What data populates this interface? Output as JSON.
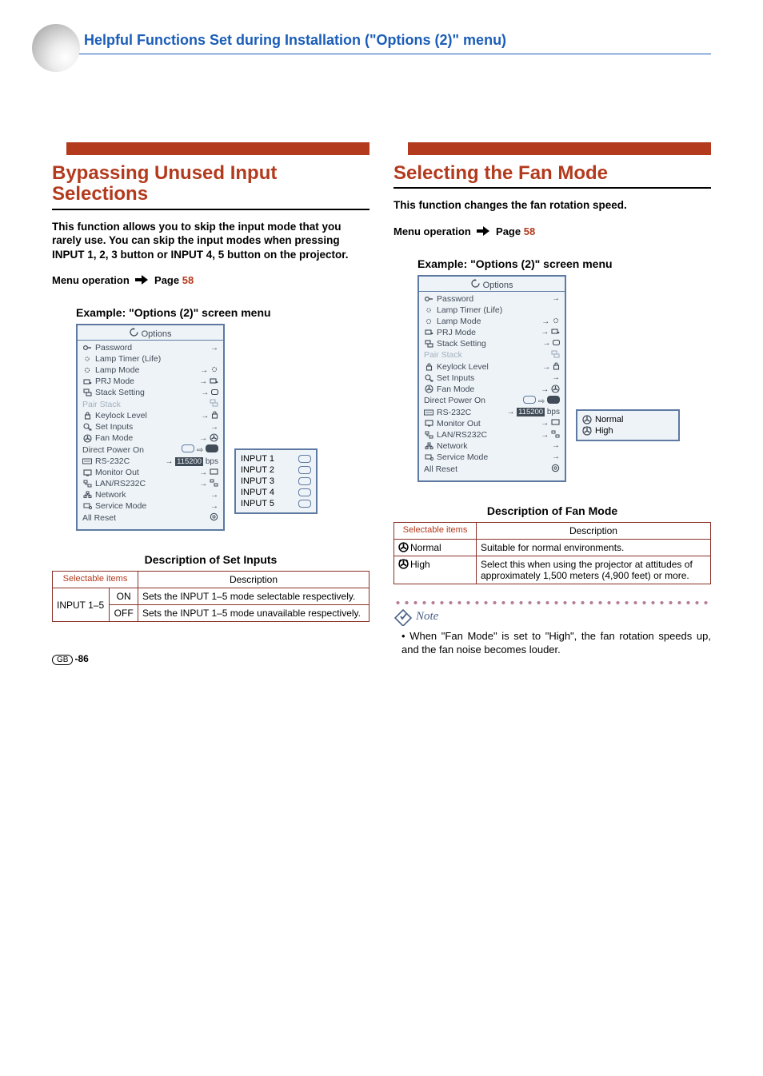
{
  "header": "Helpful Functions Set during Installation (\"Options (2)\" menu)",
  "page_number_prefix": "GB",
  "page_number": "-86",
  "menu_op_label": "Menu operation",
  "menu_op_page_word": "Page",
  "menu_op_page_num": "58",
  "left": {
    "title": "Bypassing Unused Input Selections",
    "intro": "This function allows you to skip the input mode that you rarely use. You can skip the input modes when pressing INPUT 1, 2, 3 button or INPUT 4, 5 button on the projector.",
    "example_label": "Example: \"Options (2)\" screen menu",
    "osd_title": "Options",
    "osd_items": [
      "Password",
      "Lamp Timer (Life)",
      "Lamp Mode",
      "PRJ Mode",
      "Stack Setting",
      "Pair Stack",
      "Keylock Level",
      "Set Inputs",
      "Fan Mode",
      "Direct Power On",
      "RS-232C",
      "Monitor Out",
      "LAN/RS232C",
      "Network",
      "Service Mode",
      "All Reset"
    ],
    "rs232_value": "115200",
    "rs232_unit": "bps",
    "popup_items": [
      "INPUT 1",
      "INPUT 2",
      "INPUT 3",
      "INPUT 4",
      "INPUT 5"
    ],
    "table_caption": "Description of Set Inputs",
    "table": {
      "h1": "Selectable items",
      "h2": "Description",
      "r1c1": "INPUT 1–5",
      "r1c2": "ON",
      "r1c3": "Sets the INPUT 1–5 mode selectable respectively.",
      "r2c2": "OFF",
      "r2c3": "Sets the INPUT 1–5 mode unavailable respectively."
    }
  },
  "right": {
    "title": "Selecting the Fan Mode",
    "intro": "This function changes the fan rotation speed.",
    "example_label": "Example: \"Options (2)\" screen menu",
    "osd_title": "Options",
    "osd_items": [
      "Password",
      "Lamp Timer (Life)",
      "Lamp Mode",
      "PRJ Mode",
      "Stack Setting",
      "Pair Stack",
      "Keylock Level",
      "Set Inputs",
      "Fan Mode",
      "Direct Power On",
      "RS-232C",
      "Monitor Out",
      "LAN/RS232C",
      "Network",
      "Service Mode",
      "All Reset"
    ],
    "rs232_value": "115200",
    "rs232_unit": "bps",
    "popup_items": [
      "Normal",
      "High"
    ],
    "table_caption": "Description of Fan Mode",
    "table": {
      "h1": "Selectable items",
      "h2": "Description",
      "r1c1": "Normal",
      "r1c2": "Suitable for normal environments.",
      "r2c1": "High",
      "r2c2": "Select this when using the projector at attitudes of approximately 1,500 meters (4,900 feet) or more."
    },
    "note_label": "Note",
    "note_bullet": "•",
    "note_text": "When \"Fan Mode\" is set to \"High\", the fan rotation speeds up, and the fan noise becomes louder."
  }
}
